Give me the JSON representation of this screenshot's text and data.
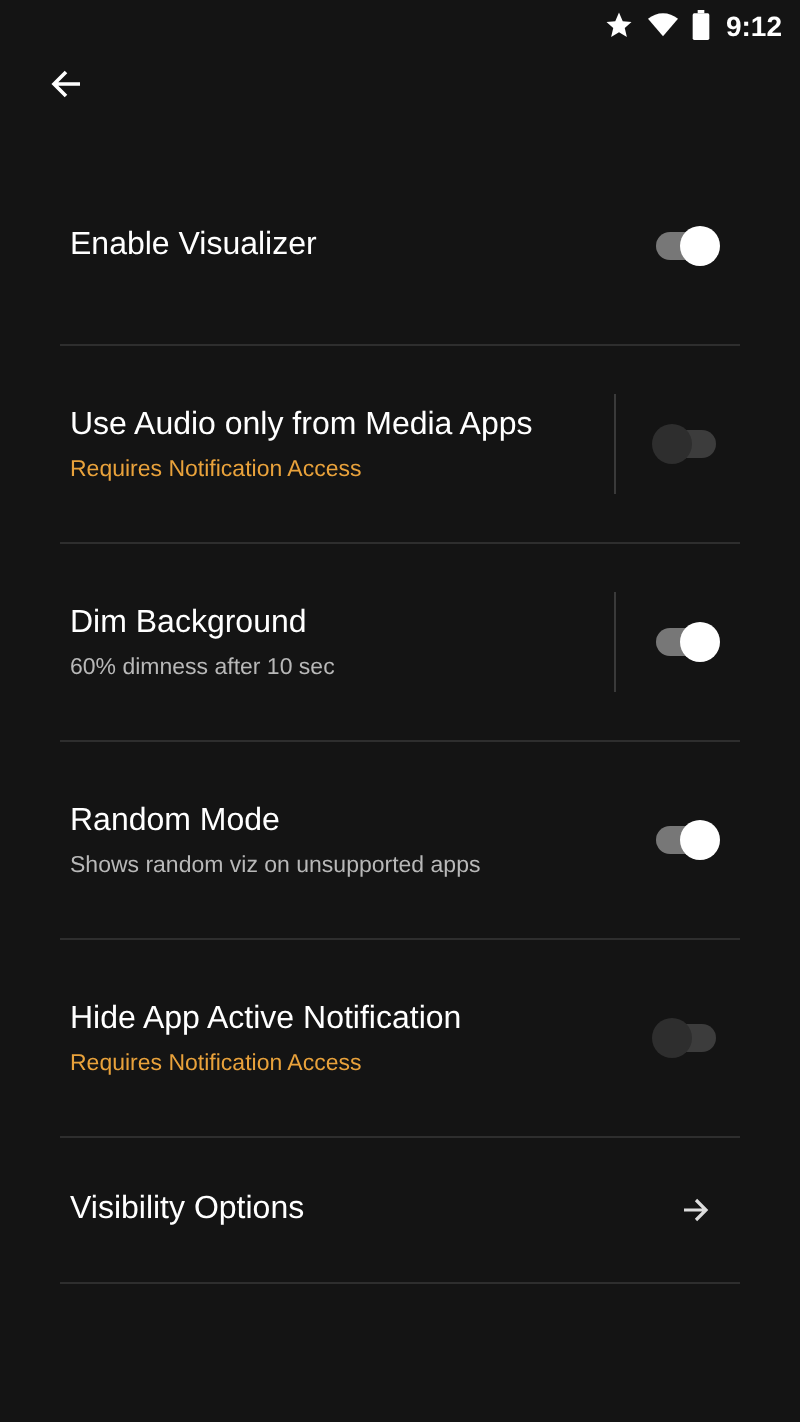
{
  "status_bar": {
    "time": "9:12"
  },
  "settings": [
    {
      "kind": "toggle",
      "title": "Enable Visualizer",
      "on": true,
      "separator": false
    },
    {
      "kind": "toggle",
      "title": "Use Audio only from Media Apps",
      "subtitle": {
        "text": "Requires Notification Access",
        "color": "#e9a23b"
      },
      "on": false,
      "separator": true
    },
    {
      "kind": "toggle",
      "title": "Dim Background",
      "subtitle": {
        "text": "60% dimness after 10 sec",
        "color": "#b8b8b8"
      },
      "on": true,
      "separator": true
    },
    {
      "kind": "toggle",
      "title": "Random Mode",
      "subtitle": {
        "text": "Shows random viz on unsupported apps",
        "color": "#b8b8b8"
      },
      "on": true,
      "separator": false
    },
    {
      "kind": "toggle",
      "title": "Hide App Active Notification",
      "subtitle": {
        "text": "Requires Notification Access",
        "color": "#e9a23b"
      },
      "on": false,
      "separator": false
    },
    {
      "kind": "link",
      "title": "Visibility Options"
    }
  ]
}
